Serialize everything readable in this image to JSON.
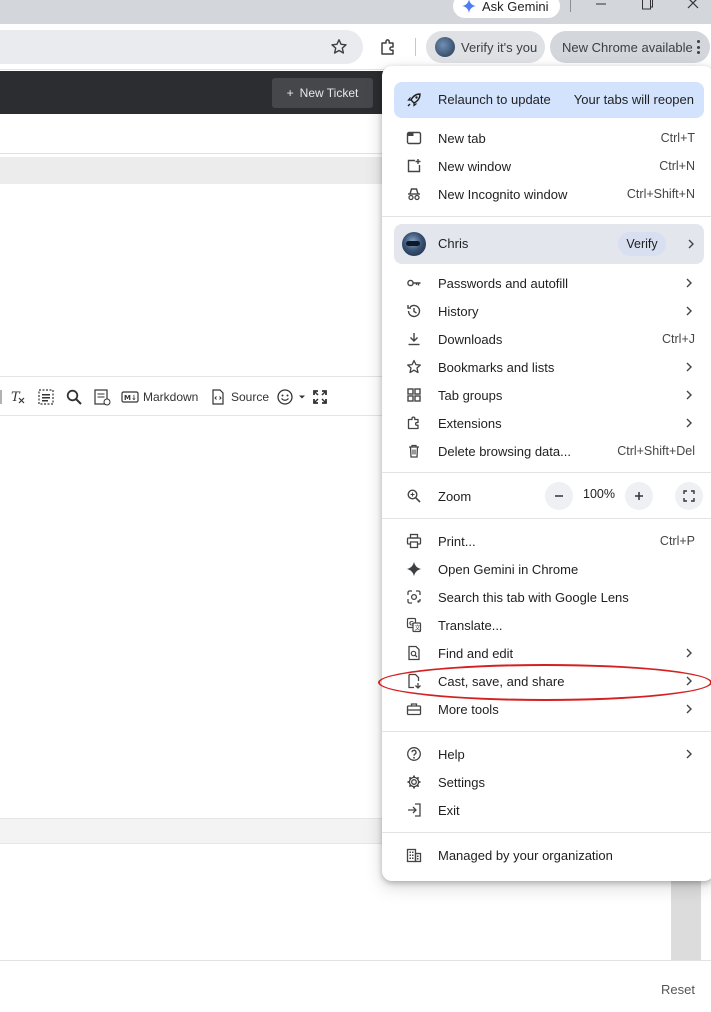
{
  "browser": {
    "ask_gemini_label": "Ask Gemini",
    "verify_chip_label": "Verify it's you",
    "new_chrome_label": "New Chrome available"
  },
  "page": {
    "new_ticket_label": "New Ticket",
    "editor_toolbar": {
      "markdown_label": "Markdown",
      "source_label": "Source"
    },
    "reset_label": "Reset"
  },
  "menu": {
    "relaunch": {
      "label": "Relaunch to update",
      "note": "Your tabs will reopen"
    },
    "group1": [
      {
        "label": "New tab",
        "shortcut": "Ctrl+T"
      },
      {
        "label": "New window",
        "shortcut": "Ctrl+N"
      },
      {
        "label": "New Incognito window",
        "shortcut": "Ctrl+Shift+N"
      }
    ],
    "profile": {
      "name": "Chris",
      "verify_label": "Verify"
    },
    "group2": [
      {
        "label": "Passwords and autofill",
        "shortcut": ""
      },
      {
        "label": "History",
        "shortcut": ""
      },
      {
        "label": "Downloads",
        "shortcut": "Ctrl+J"
      },
      {
        "label": "Bookmarks and lists",
        "shortcut": ""
      },
      {
        "label": "Tab groups",
        "shortcut": ""
      },
      {
        "label": "Extensions",
        "shortcut": ""
      },
      {
        "label": "Delete browsing data...",
        "shortcut": "Ctrl+Shift+Del"
      }
    ],
    "zoom": {
      "label": "Zoom",
      "value": "100%"
    },
    "group3": [
      {
        "label": "Print...",
        "shortcut": "Ctrl+P"
      },
      {
        "label": "Open Gemini in Chrome",
        "shortcut": ""
      },
      {
        "label": "Search this tab with Google Lens",
        "shortcut": ""
      },
      {
        "label": "Translate...",
        "shortcut": ""
      },
      {
        "label": "Find and edit",
        "shortcut": ""
      },
      {
        "label": "Cast, save, and share",
        "shortcut": ""
      },
      {
        "label": "More tools",
        "shortcut": ""
      }
    ],
    "group4": [
      {
        "label": "Help"
      },
      {
        "label": "Settings"
      },
      {
        "label": "Exit"
      }
    ],
    "managed_label": "Managed by your organization"
  },
  "colors": {
    "relaunch_bg": "#d3e3fd",
    "annotation_red": "#d42020",
    "app_topbar": "#2b2d30"
  }
}
